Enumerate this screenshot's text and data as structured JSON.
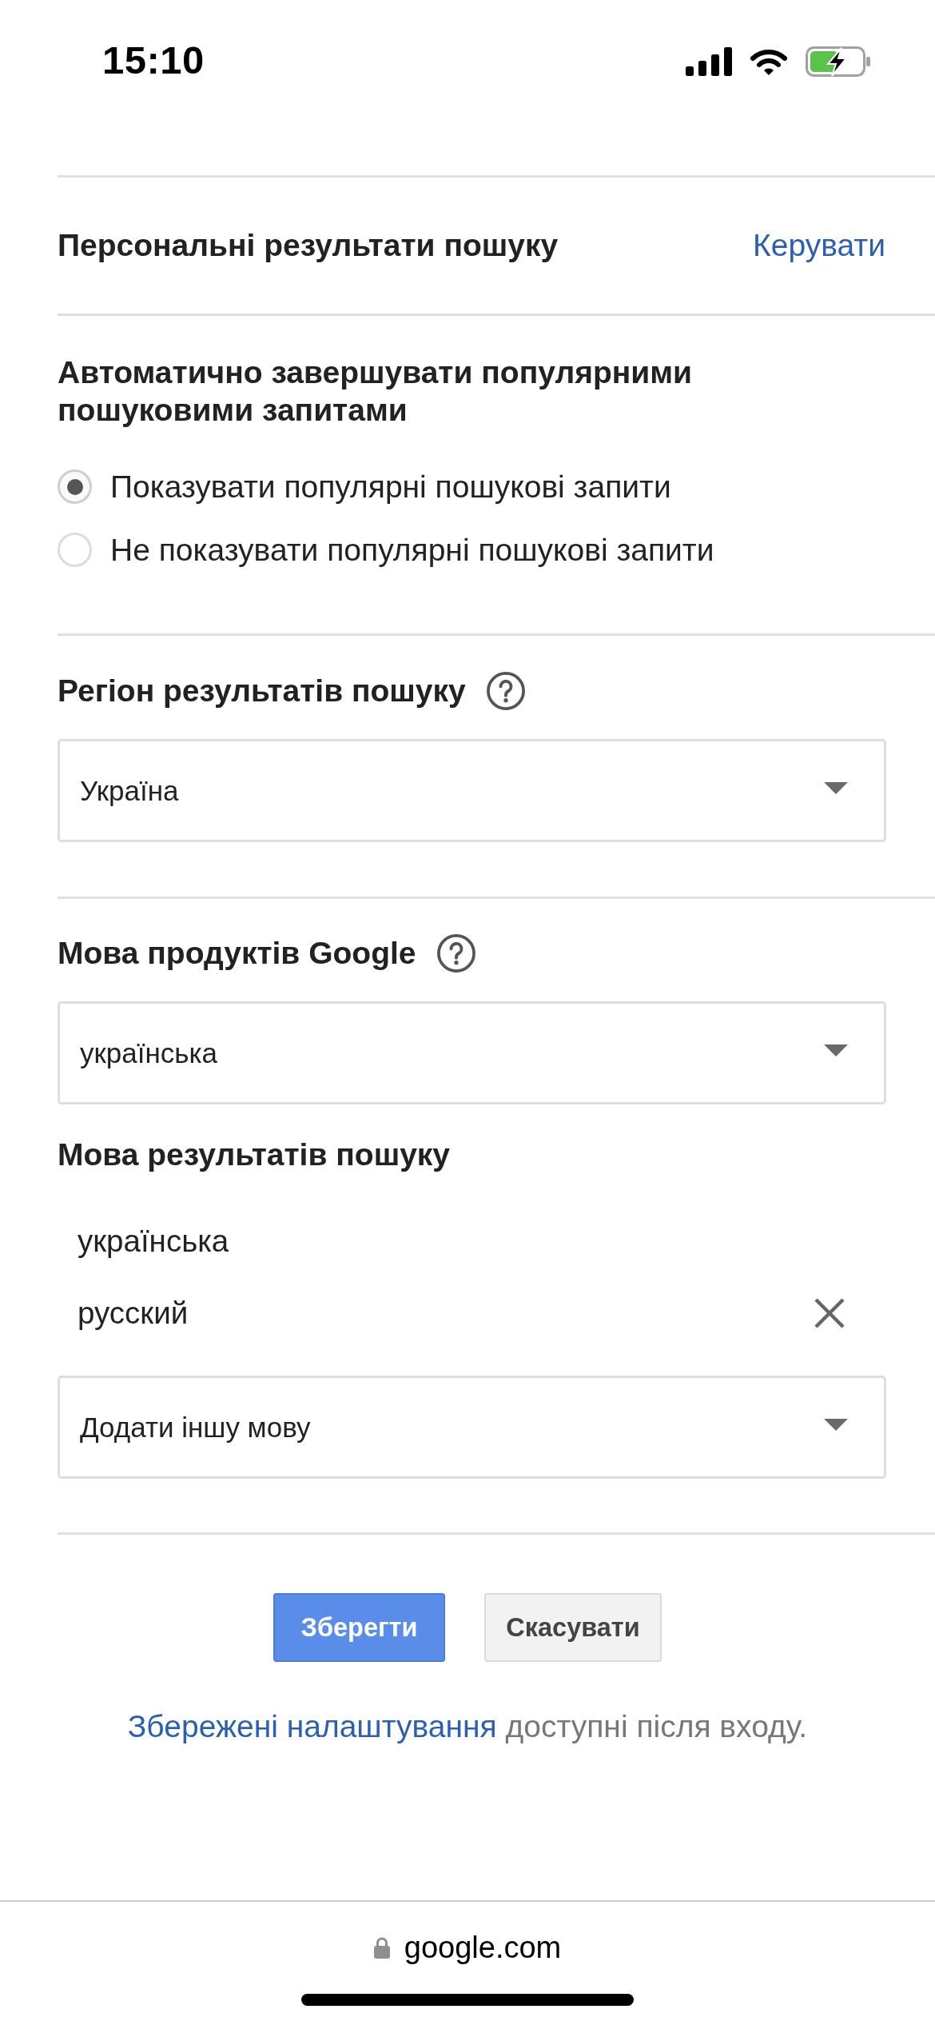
{
  "status_bar": {
    "time": "15:10"
  },
  "personal_results": {
    "title": "Персональні результати пошуку",
    "link": "Керувати"
  },
  "autocomplete": {
    "title": "Автоматично завершувати популярними пошуковими запитами",
    "options": [
      {
        "label": "Показувати популярні пошукові запити",
        "selected": true
      },
      {
        "label": "Не показувати популярні пошукові запити",
        "selected": false
      }
    ]
  },
  "region": {
    "title": "Регіон результатів пошуку",
    "select": {
      "value": "Україна"
    }
  },
  "product_language": {
    "title": "Мова продуктів Google",
    "select": {
      "value": "українська"
    }
  },
  "results_language": {
    "title": "Мова результатів пошуку",
    "languages": [
      {
        "name": "українська",
        "removable": false
      },
      {
        "name": "русский",
        "removable": true
      }
    ],
    "add_select": {
      "value": "Додати іншу мову"
    }
  },
  "buttons": [
    {
      "label": "Зберегти",
      "kind": "primary"
    },
    {
      "label": "Скасувати",
      "kind": "secondary"
    }
  ],
  "footer_note": {
    "link": "Збережені налаштування",
    "text": "доступні після входу."
  },
  "browser_bar": {
    "url": "google.com"
  }
}
